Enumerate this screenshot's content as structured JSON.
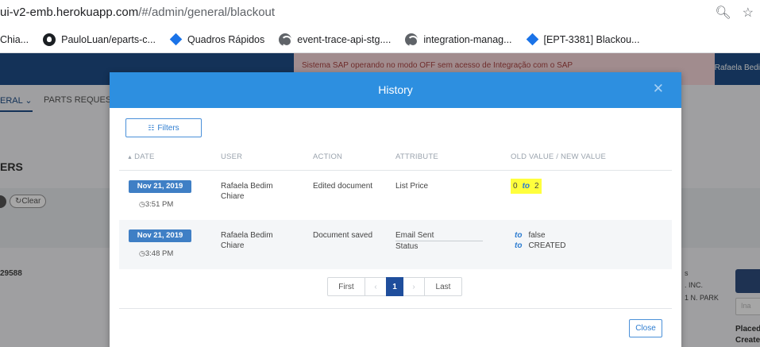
{
  "browser": {
    "url_prefix": "ui-v2-emb.herokuapp.com",
    "url_path": "/#/admin/general/blackout",
    "zoom_icon": "zoom-icon",
    "star_icon": "star-icon",
    "bookmarks": [
      {
        "label": "Chia...",
        "icon": "none"
      },
      {
        "label": "PauloLuan/eparts-c...",
        "icon": "github-icon"
      },
      {
        "label": "Quadros Rápidos",
        "icon": "diamond-icon"
      },
      {
        "label": "event-trace-api-stg....",
        "icon": "globe-icon"
      },
      {
        "label": "integration-manag...",
        "icon": "globe-icon"
      },
      {
        "label": "[EPT-3381] Blackou...",
        "icon": "diamond-icon"
      }
    ]
  },
  "background_app": {
    "banner": "Sistema SAP operando no modo OFF sem acesso de Integração com o SAP",
    "user": "Rafaela Bedi",
    "nav": {
      "general": "ERAL",
      "parts": "PARTS REQUEST"
    },
    "section_title": "ERS",
    "clear_label": "Clear",
    "record_id": "29588",
    "right_text": [
      "s",
      ". INC.",
      "1 N. PARK"
    ],
    "right_input_placeholder": "Ina",
    "right_labels": [
      "Placed",
      "Create"
    ]
  },
  "modal": {
    "title": "History",
    "close_icon": "close-icon",
    "filters_label": "Filters",
    "columns": {
      "date": "DATE",
      "user": "USER",
      "action": "ACTION",
      "attribute": "ATTRIBUTE",
      "values": "OLD VALUE / NEW VALUE"
    },
    "rows": [
      {
        "date": "Nov 21, 2019",
        "time": "3:51 PM",
        "user": "Rafaela Bedim Chiare",
        "action": "Edited document",
        "attributes": [
          "List Price"
        ],
        "changes": [
          {
            "old": "0",
            "to": "to",
            "new": "2"
          }
        ]
      },
      {
        "date": "Nov 21, 2019",
        "time": "3:48 PM",
        "user": "Rafaela Bedim Chiare",
        "action": "Document saved",
        "attributes": [
          "Email Sent",
          "Status"
        ],
        "changes": [
          {
            "to": "to",
            "new": "false"
          },
          {
            "to": "to",
            "new": "CREATED"
          }
        ]
      }
    ],
    "pagination": {
      "first": "First",
      "prev": "‹",
      "current": "1",
      "next": "›",
      "last": "Last"
    },
    "close_label": "Close"
  },
  "colors": {
    "modal_header": "#2d8fe0",
    "date_badge": "#3f7fc5",
    "highlight": "#ffff3d",
    "active_page": "#1f4e9c"
  }
}
